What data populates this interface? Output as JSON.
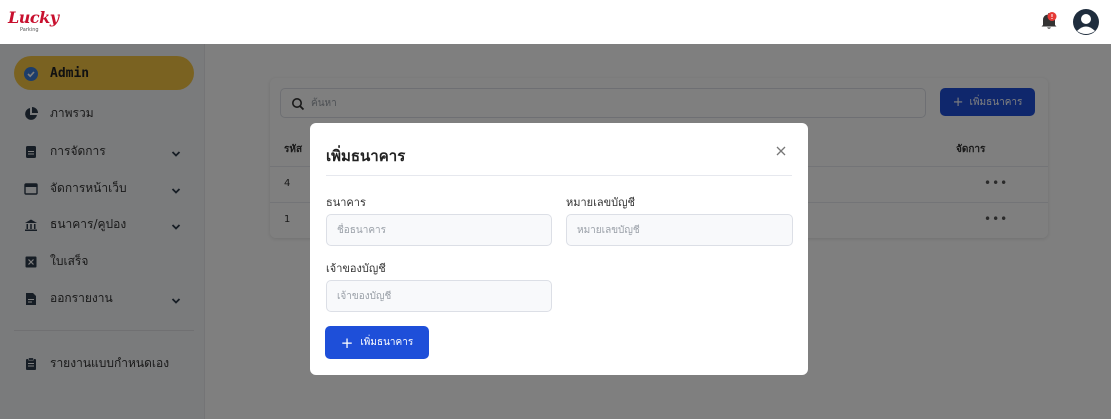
{
  "brand": {
    "logo_text": "Lucky",
    "logo_sub": "Parking"
  },
  "sidebar": {
    "items": [
      {
        "label": "Admin",
        "icon": "shield-check-icon",
        "active": true
      },
      {
        "label": "ภาพรวม",
        "icon": "pie-chart-icon"
      },
      {
        "label": "การจัดการ",
        "icon": "document-icon",
        "has_children": true
      },
      {
        "label": "จัดการหน้าเว็บ",
        "icon": "window-icon",
        "has_children": true
      },
      {
        "label": "ธนาคาร/คูปอง",
        "icon": "bank-icon",
        "has_children": true
      },
      {
        "label": "ใบเสร็จ",
        "icon": "receipt-icon"
      },
      {
        "label": "ออกรายงาน",
        "icon": "report-icon",
        "has_children": true
      },
      {
        "label": "รายงานแบบกำหนดเอง",
        "icon": "clipboard-icon"
      }
    ]
  },
  "main": {
    "search": {
      "placeholder": "ค้นหา"
    },
    "add_button_label": "เพิ่มธนาคาร",
    "table": {
      "headers": [
        "รหัส",
        "จัดการ"
      ],
      "rows": [
        {
          "id": "4",
          "actions": "•••"
        },
        {
          "id": "1",
          "actions": "•••"
        }
      ]
    }
  },
  "modal": {
    "title": "เพิ่มธนาคาร",
    "fields": {
      "bank": {
        "label": "ธนาคาร",
        "placeholder": "ชื่อธนาคาร"
      },
      "account_no": {
        "label": "หมายเลขบัญชี",
        "placeholder": "หมายเลขบัญชี"
      },
      "owner": {
        "label": "เจ้าของบัญชี",
        "placeholder": "เจ้าของบัญชี"
      }
    },
    "submit_label": "เพิ่มธนาคาร"
  },
  "colors": {
    "accent": "#1e4fd9",
    "active_nav": "#f4c542",
    "brand": "#c8102e",
    "notification": "#e53935"
  }
}
